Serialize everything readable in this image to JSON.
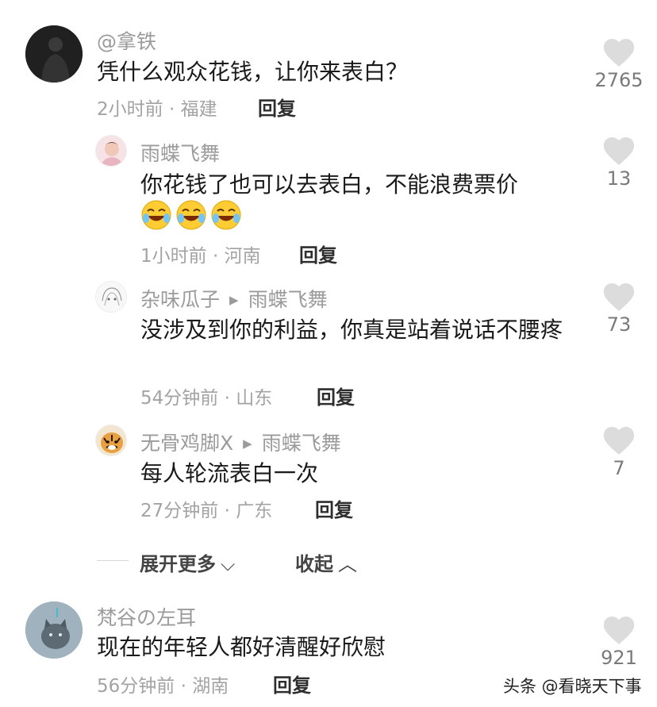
{
  "comments": [
    {
      "username": "@拿铁",
      "text": "凭什么观众花钱，让你来表白？",
      "time_location": "2小时前 · 福建",
      "reply_label": "回复",
      "like_count": "2765",
      "replies": [
        {
          "username": "雨蝶飞舞",
          "text": "你花钱了也可以去表白，不能浪费票价",
          "emoji_count": "3",
          "time_location": "1小时前 · 河南",
          "reply_label": "回复",
          "like_count": "13"
        },
        {
          "username": "杂味瓜子",
          "reply_to": "雨蝶飞舞",
          "text": "没涉及到你的利益，你真是站着说话不腰疼",
          "time_location": "54分钟前 · 山东",
          "reply_label": "回复",
          "like_count": "73"
        },
        {
          "username": "无骨鸡脚X",
          "reply_to": "雨蝶飞舞",
          "text": "每人轮流表白一次",
          "time_location": "27分钟前 · 广东",
          "reply_label": "回复",
          "like_count": "7"
        }
      ],
      "expand_more_label": "展开更多",
      "collapse_label": "收起"
    },
    {
      "username": "梵谷の左耳",
      "text": "现在的年轻人都好清醒好欣慰",
      "time_location": "56分钟前 · 湖南",
      "reply_label": "回复",
      "like_count": "921"
    }
  ],
  "watermark": "头条 @看晓天下事",
  "colors": {
    "heart": "#dcdcdc",
    "username": "#9b9b9b",
    "text": "#1a1a1a",
    "meta": "#a3a3a3"
  },
  "icons": [
    "heart-icon",
    "reply-arrow-icon",
    "chevron-down-icon",
    "chevron-up-icon",
    "laughing-emoji-icon"
  ]
}
